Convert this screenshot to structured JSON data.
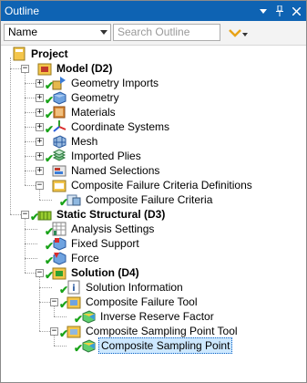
{
  "titlebar": {
    "title": "Outline",
    "buttons": [
      "dropdown",
      "pin",
      "close"
    ]
  },
  "toolbar": {
    "filter_value": "Name",
    "search_placeholder": "Search Outline"
  },
  "tree": [
    {
      "label": "Project",
      "bold": true,
      "expander": "",
      "check": false,
      "icon": "project-icon"
    },
    {
      "label": "Model (D2)",
      "bold": true,
      "expander": "-",
      "check": false,
      "icon": "model-icon"
    },
    {
      "label": "Geometry Imports",
      "bold": false,
      "expander": "+",
      "check": true,
      "icon": "geometry-imports-icon"
    },
    {
      "label": "Geometry",
      "bold": false,
      "expander": "+",
      "check": true,
      "icon": "geometry-icon"
    },
    {
      "label": "Materials",
      "bold": false,
      "expander": "+",
      "check": true,
      "icon": "materials-icon"
    },
    {
      "label": "Coordinate Systems",
      "bold": false,
      "expander": "+",
      "check": true,
      "icon": "coordinate-systems-icon"
    },
    {
      "label": "Mesh",
      "bold": false,
      "expander": "+",
      "check": false,
      "icon": "mesh-icon"
    },
    {
      "label": "Imported Plies",
      "bold": false,
      "expander": "+",
      "check": true,
      "icon": "imported-plies-icon"
    },
    {
      "label": "Named Selections",
      "bold": false,
      "expander": "+",
      "check": false,
      "icon": "named-selections-icon"
    },
    {
      "label": "Composite Failure Criteria Definitions",
      "bold": false,
      "expander": "-",
      "check": false,
      "icon": "composite-failure-criteria-definitions-icon"
    },
    {
      "label": "Composite Failure Criteria",
      "bold": false,
      "expander": "",
      "check": true,
      "icon": "composite-failure-criteria-icon"
    },
    {
      "label": "Static Structural (D3)",
      "bold": true,
      "expander": "-",
      "check": true,
      "icon": "static-structural-icon"
    },
    {
      "label": "Analysis Settings",
      "bold": false,
      "expander": "",
      "check": true,
      "icon": "analysis-settings-icon"
    },
    {
      "label": "Fixed Support",
      "bold": false,
      "expander": "",
      "check": true,
      "icon": "fixed-support-icon"
    },
    {
      "label": "Force",
      "bold": false,
      "expander": "",
      "check": true,
      "icon": "force-icon"
    },
    {
      "label": "Solution (D4)",
      "bold": true,
      "expander": "-",
      "check": true,
      "icon": "solution-icon"
    },
    {
      "label": "Solution Information",
      "bold": false,
      "expander": "",
      "check": true,
      "icon": "solution-information-icon"
    },
    {
      "label": "Composite Failure Tool",
      "bold": false,
      "expander": "-",
      "check": true,
      "icon": "composite-failure-tool-icon"
    },
    {
      "label": "Inverse Reserve Factor",
      "bold": false,
      "expander": "",
      "check": true,
      "icon": "inverse-reserve-factor-icon"
    },
    {
      "label": "Composite Sampling Point Tool",
      "bold": false,
      "expander": "-",
      "check": true,
      "icon": "composite-sampling-point-tool-icon"
    },
    {
      "label": "Composite Sampling Point",
      "bold": false,
      "expander": "",
      "check": true,
      "icon": "composite-sampling-point-icon",
      "selected": true
    }
  ],
  "colors": {
    "titlebar": "#0e63b3",
    "check": "#19a319",
    "selection": "#cde8ff",
    "search_button": "#e8a317"
  }
}
